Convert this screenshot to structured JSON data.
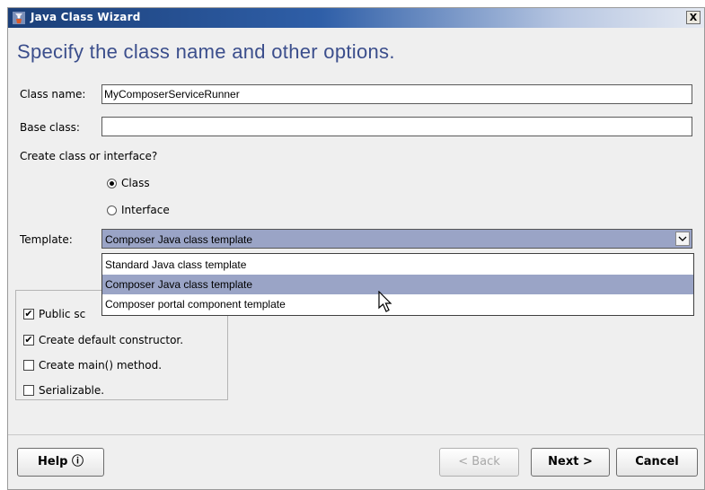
{
  "window": {
    "title": "Java Class Wizard",
    "close_label": "X"
  },
  "heading": "Specify the class name and other options.",
  "form": {
    "class_name_label": "Class name:",
    "class_name_value": "MyComposerServiceRunner",
    "base_class_label": "Base class:",
    "base_class_value": "",
    "kind_question": "Create class or interface?",
    "radio_class": "Class",
    "radio_interface": "Interface",
    "selected_kind": "Class",
    "template_label": "Template:",
    "template_value": "Composer Java class template"
  },
  "template_options": [
    {
      "label": "Standard Java class template"
    },
    {
      "label": "Composer Java class template",
      "selected": true
    },
    {
      "label": "Composer portal component template"
    }
  ],
  "options": {
    "public_scope": "Public sc",
    "public_scope_checked": true,
    "default_constructor": "Create default constructor.",
    "default_constructor_checked": true,
    "main_method": "Create main() method.",
    "main_method_checked": false,
    "serializable": "Serializable.",
    "serializable_checked": false
  },
  "buttons": {
    "help": "Help ⓘ",
    "back": "< Back",
    "back_enabled": false,
    "next": "Next >",
    "cancel": "Cancel"
  },
  "colors": {
    "titlebar": "#1b3f78",
    "heading": "#3b4e8c",
    "selection": "#9aa4c6"
  },
  "icons": {
    "app": "java-wizard-icon",
    "close": "close-icon",
    "combo": "chevron-down-icon",
    "pointer": "mouse-pointer-icon"
  }
}
